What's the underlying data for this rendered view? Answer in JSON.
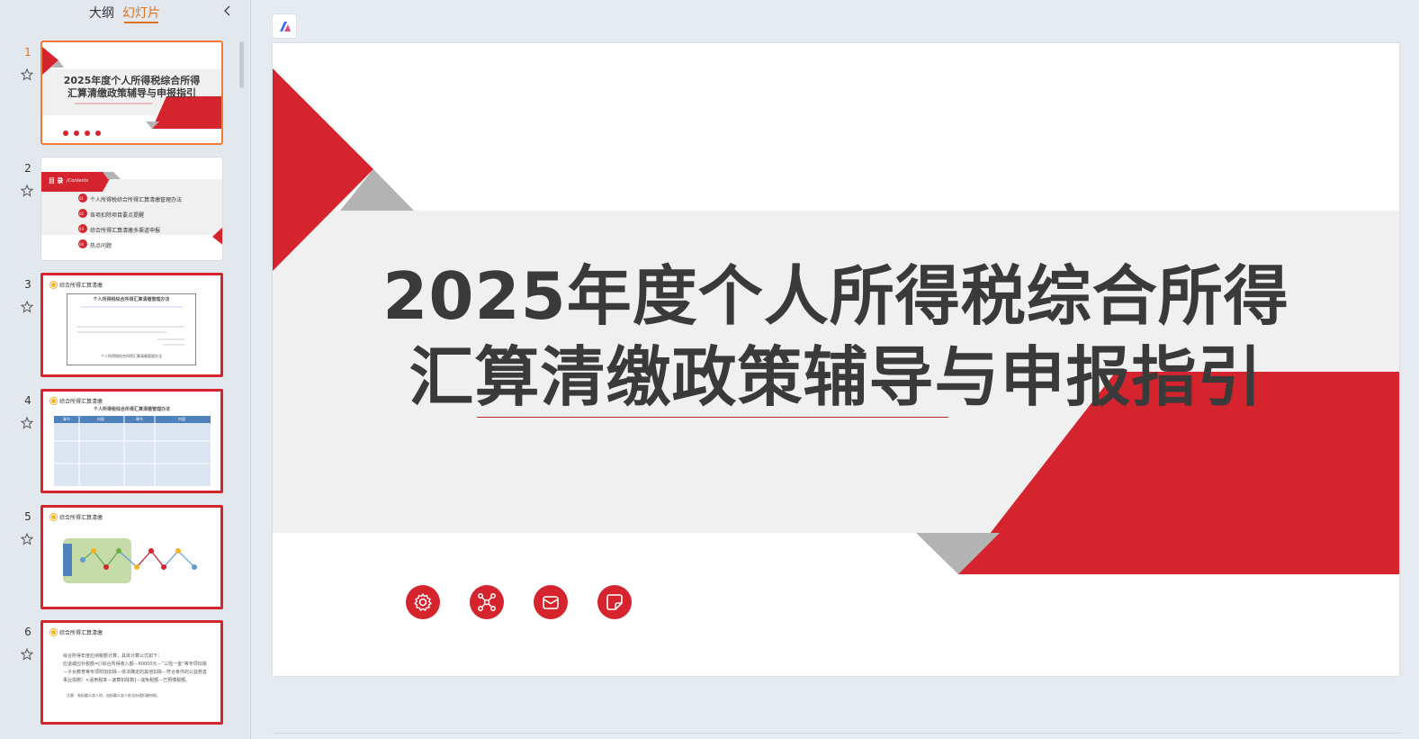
{
  "tabs": {
    "outline": "大纲",
    "slides": "幻灯片"
  },
  "colors": {
    "accent": "#d5242e",
    "active_tab": "#e0711f",
    "selected_border": "#f07a3a",
    "gray_triangle": "#b3b3b3",
    "band": "#f0f0f0"
  },
  "slides": [
    {
      "number": "1",
      "title_line1": "2025年度个人所得税综合所得",
      "title_line2": "汇算清缴政策辅导与申报指引"
    },
    {
      "number": "2",
      "toc_label": "目 录",
      "toc_sub": "/Contents",
      "toc_items": [
        {
          "num": "01",
          "text": "个人所得税综合所得汇算清缴管理办法"
        },
        {
          "num": "02",
          "text": "各项扣除项目要点提醒"
        },
        {
          "num": "03",
          "text": "综合所得汇算清缴多渠道申报"
        },
        {
          "num": "04",
          "text": "热点问题"
        }
      ]
    },
    {
      "number": "3",
      "header": "综合所得汇算清缴",
      "doc_title": "个人所得税综合所得汇算清缴管理办法",
      "doc_footer": "个人所得税综合所得汇算清缴管理办法"
    },
    {
      "number": "4",
      "header": "综合所得汇算清缴",
      "table_title": "个人所得税综合所得汇算清缴管理办法",
      "table_headers": [
        "章节",
        "内容",
        "章节",
        "内容"
      ]
    },
    {
      "number": "5",
      "header": "综合所得汇算清缴"
    },
    {
      "number": "6",
      "header": "综合所得汇算清缴",
      "body_line1": "综合所得年度应纳税额计算，具体计算公式如下：",
      "body_line2": "应退或应补税额=[（综合所得收入额－60000元－“三险一金”等专项扣除－子女教育等专项附加扣除－依法确定的其他扣除－符合条件的公益慈善事业捐赠）×适用税率－速算扣除数]－减免税额－已预缴税额。",
      "body_note": "注意：有扣缴义务人的，由扣缴义务人依法办理扣缴申报。"
    }
  ],
  "main_slide": {
    "title_line1": "2025年度个人所得税综合所得",
    "title_line2": "汇算清缴政策辅导与申报指引",
    "icons": [
      "gear-icon",
      "network-icon",
      "mail-icon",
      "note-icon"
    ]
  }
}
